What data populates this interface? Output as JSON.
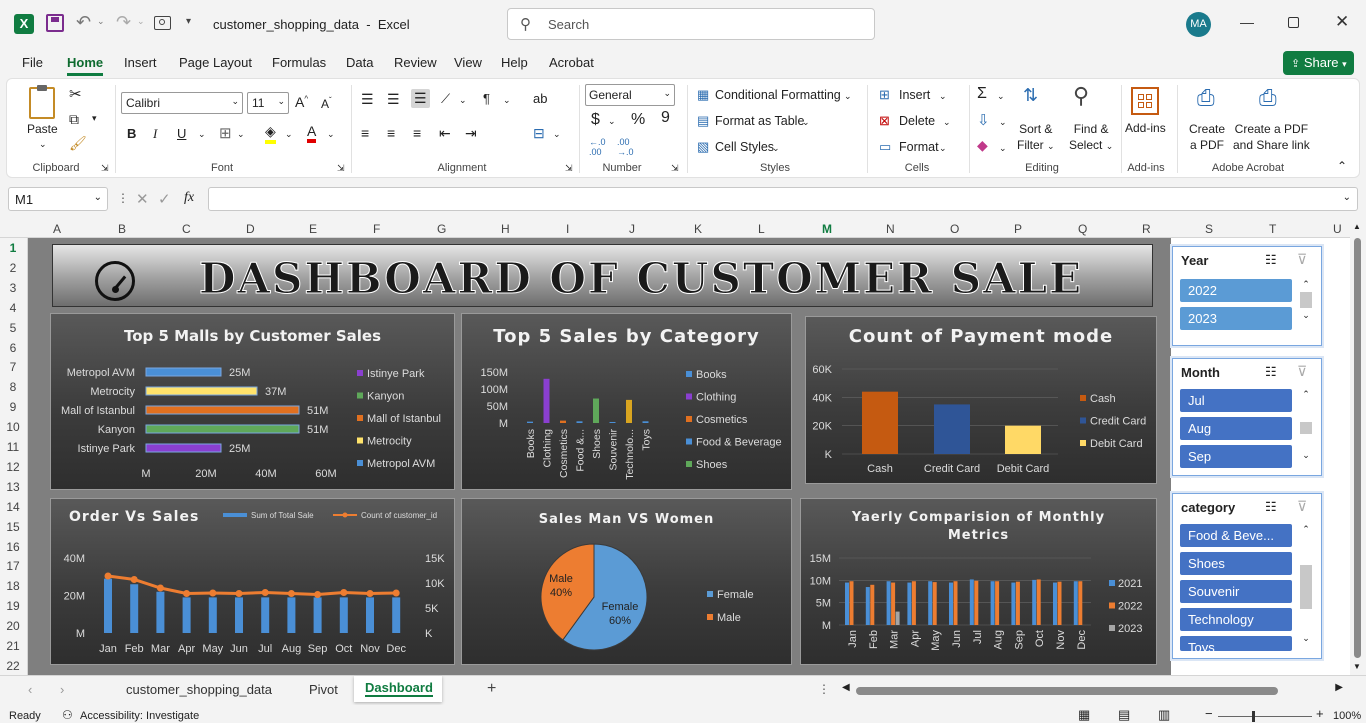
{
  "titlebar": {
    "doc_title": "customer_shopping_data",
    "sep": "-",
    "app": "Excel",
    "search_placeholder": "Search",
    "avatar": "MA"
  },
  "menu": [
    "File",
    "Home",
    "Insert",
    "Page Layout",
    "Formulas",
    "Data",
    "Review",
    "View",
    "Help",
    "Acrobat"
  ],
  "share_label": "Share",
  "ribbon": {
    "clipboard": {
      "paste": "Paste",
      "label": "Clipboard"
    },
    "font": {
      "name": "Calibri",
      "size": "11",
      "label": "Font"
    },
    "alignment": {
      "label": "Alignment"
    },
    "number": {
      "format": "General",
      "label": "Number"
    },
    "styles": {
      "cond": "Conditional Formatting",
      "table": "Format as Table",
      "cell": "Cell Styles",
      "label": "Styles"
    },
    "cells": {
      "insert": "Insert",
      "delete": "Delete",
      "format": "Format",
      "label": "Cells"
    },
    "editing": {
      "sort": "Sort &",
      "sort2": "Filter",
      "find": "Find &",
      "find2": "Select",
      "label": "Editing"
    },
    "addins": {
      "btn": "Add-ins",
      "label": "Add-ins"
    },
    "acrobat": {
      "pdf1": "Create",
      "pdf2": "a PDF",
      "share1": "Create a PDF",
      "share2": "and Share link",
      "label": "Adobe Acrobat"
    }
  },
  "formula_bar": {
    "cell_ref": "M1",
    "fx": "fx",
    "value": ""
  },
  "columns": [
    "A",
    "B",
    "C",
    "D",
    "E",
    "F",
    "G",
    "H",
    "I",
    "J",
    "K",
    "L",
    "M",
    "N",
    "O",
    "P",
    "Q",
    "R",
    "S",
    "T",
    "U"
  ],
  "rows": [
    "1",
    "2",
    "3",
    "4",
    "5",
    "6",
    "7",
    "8",
    "9",
    "10",
    "11",
    "12",
    "13",
    "14",
    "15",
    "16",
    "17",
    "18",
    "19",
    "20",
    "21",
    "22"
  ],
  "dashboard_title": "DASHBOARD OF CUSTOMER SALE",
  "charts": {
    "malls": {
      "title": "Top 5 Malls by Customer Sales"
    },
    "category": {
      "title": "Top 5 Sales by Category"
    },
    "payment": {
      "title": "Count of Payment mode"
    },
    "order": {
      "title": "Order Vs Sales"
    },
    "gender": {
      "title": "Sales Man VS Women"
    },
    "yearly": {
      "title": "Yaerly Comparision of Monthly",
      "title2": "Metrics"
    }
  },
  "chart_data": [
    {
      "type": "bar",
      "title": "Top 5 Malls by Customer Sales",
      "orientation": "horizontal",
      "categories": [
        "Metropol AVM",
        "Metrocity",
        "Mall of Istanbul",
        "Kanyon",
        "Istinye Park"
      ],
      "values": [
        25,
        37,
        51,
        51,
        25
      ],
      "data_labels": [
        "25M",
        "37M",
        "51M",
        "51M",
        "25M"
      ],
      "colors": [
        "#4a8fd6",
        "#ffe36b",
        "#e07020",
        "#5fa85a",
        "#8a3fd0"
      ],
      "x_ticks": [
        "M",
        "20M",
        "40M",
        "60M"
      ],
      "xlim": [
        0,
        60
      ],
      "legend": [
        "Istinye Park",
        "Kanyon",
        "Mall of Istanbul",
        "Metrocity",
        "Metropol AVM"
      ],
      "legend_colors": [
        "#8a3fd0",
        "#5fa85a",
        "#e07020",
        "#ffe36b",
        "#4a8fd6"
      ],
      "legend_position": "right"
    },
    {
      "type": "bar",
      "title": "Top 5 Sales by Category",
      "categories": [
        "Books",
        "Clothing",
        "Cosmetics",
        "Food &...",
        "Shoes",
        "Souvenir",
        "Technolo...",
        "Toys"
      ],
      "values": [
        4,
        130,
        7,
        5,
        72,
        3,
        68,
        5
      ],
      "colors": [
        "#4a8fd6",
        "#8a3fd0",
        "#e07020",
        "#4a8fd6",
        "#5fa85a",
        "#4a8fd6",
        "#d9a520",
        "#4a8fd6"
      ],
      "y_ticks": [
        "M",
        "50M",
        "100M",
        "150M"
      ],
      "ylim": [
        0,
        150
      ],
      "legend": [
        "Books",
        "Clothing",
        "Cosmetics",
        "Food & Beverage",
        "Shoes"
      ],
      "legend_colors": [
        "#4a8fd6",
        "#8a3fd0",
        "#e07020",
        "#4a8fd6",
        "#5fa85a"
      ],
      "legend_position": "right"
    },
    {
      "type": "bar",
      "title": "Count of Payment mode",
      "categories": [
        "Cash",
        "Credit Card",
        "Debit Card"
      ],
      "values": [
        44,
        35,
        20
      ],
      "colors": [
        "#c55a11",
        "#2f5597",
        "#ffd966"
      ],
      "y_ticks": [
        "K",
        "20K",
        "40K",
        "60K"
      ],
      "ylim": [
        0,
        60
      ],
      "legend": [
        "Cash",
        "Credit Card",
        "Debit Card"
      ],
      "legend_position": "right"
    },
    {
      "type": "bar",
      "title": "Order Vs Sales",
      "categories": [
        "Jan",
        "Feb",
        "Mar",
        "Apr",
        "May",
        "Jun",
        "Jul",
        "Aug",
        "Sep",
        "Oct",
        "Nov",
        "Dec"
      ],
      "series": [
        {
          "name": "Sum of Total Sale",
          "kind": "bar",
          "axis": "left",
          "values": [
            29,
            26,
            22,
            19,
            19,
            19,
            19,
            19,
            19,
            19,
            19,
            19
          ]
        },
        {
          "name": "Count of customer_id",
          "kind": "line",
          "axis": "right",
          "values": [
            11.4,
            10.7,
            9.0,
            7.9,
            8.0,
            7.9,
            8.1,
            7.9,
            7.7,
            8.1,
            7.9,
            8.0
          ]
        }
      ],
      "y_ticks_left": [
        "M",
        "20M",
        "40M"
      ],
      "ylim_left": [
        0,
        40
      ],
      "y_ticks_right": [
        "K",
        "5K",
        "10K",
        "15K"
      ],
      "ylim_right": [
        0,
        15
      ],
      "legend_position": "top"
    },
    {
      "type": "pie",
      "title": "Sales Man VS Women",
      "categories": [
        "Female",
        "Male"
      ],
      "values": [
        60,
        40
      ],
      "data_labels": [
        "Female\n60%",
        "Male\n40%"
      ],
      "colors": [
        "#5b9bd5",
        "#ed7d31"
      ],
      "legend_position": "right"
    },
    {
      "type": "bar",
      "title": "Yaerly Comparision of Monthly Metrics",
      "categories": [
        "Jan",
        "Feb",
        "Mar",
        "Apr",
        "May",
        "Jun",
        "Jul",
        "Aug",
        "Sep",
        "Oct",
        "Nov",
        "Dec"
      ],
      "series": [
        {
          "name": "2021",
          "values": [
            9.5,
            8.5,
            9.8,
            9.5,
            9.8,
            9.5,
            10.2,
            9.8,
            9.5,
            10.1,
            9.5,
            9.8
          ]
        },
        {
          "name": "2022",
          "values": [
            9.8,
            9.0,
            9.5,
            9.8,
            9.6,
            9.8,
            9.9,
            9.8,
            9.7,
            10.2,
            9.7,
            9.8
          ]
        },
        {
          "name": "2023",
          "values": [
            0,
            0,
            3,
            0,
            0,
            0,
            0,
            0,
            0,
            0,
            0,
            0
          ]
        }
      ],
      "colors": [
        "#4a8fd6",
        "#ed7d31",
        "#a5a5a5"
      ],
      "y_ticks": [
        "M",
        "5M",
        "10M",
        "15M"
      ],
      "ylim": [
        0,
        15
      ],
      "legend_position": "right"
    }
  ],
  "slicers": {
    "year": {
      "title": "Year",
      "items": [
        "2022",
        "2023"
      ]
    },
    "month": {
      "title": "Month",
      "items": [
        "Jul",
        "Aug",
        "Sep"
      ]
    },
    "category": {
      "title": "category",
      "items": [
        "Food & Beve...",
        "Shoes",
        "Souvenir",
        "Technology",
        "Toys"
      ]
    }
  },
  "tabs": [
    "customer_shopping_data",
    "Pivot",
    "Dashboard"
  ],
  "status": {
    "ready": "Ready",
    "accessibility": "Accessibility: Investigate",
    "zoom": "100%"
  }
}
